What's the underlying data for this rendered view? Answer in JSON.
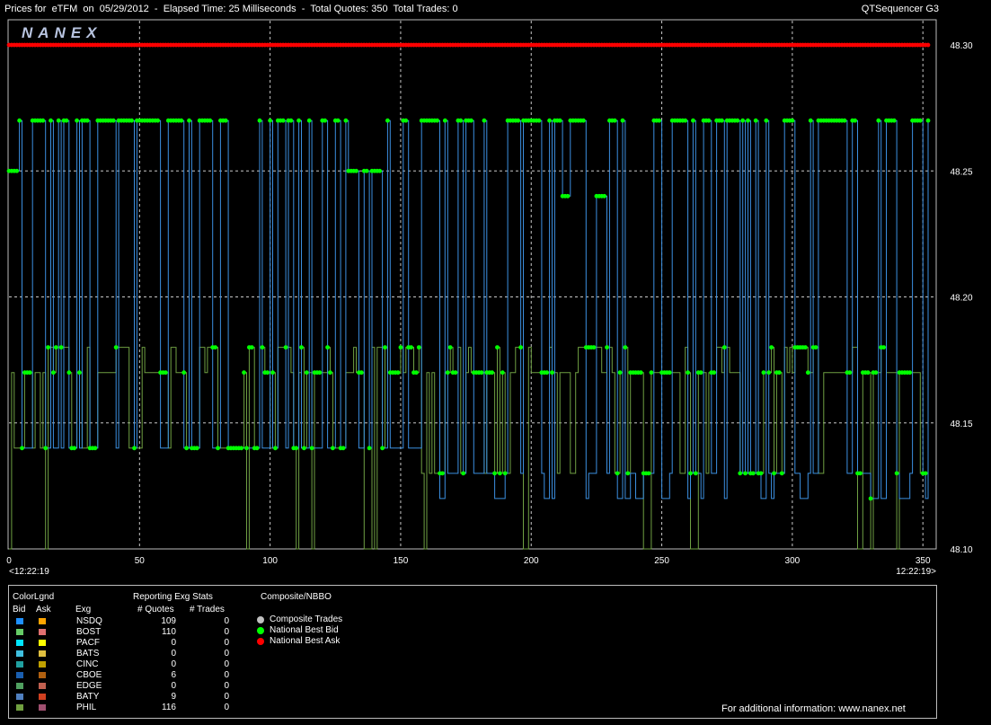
{
  "header": {
    "title": "Prices for  eTFM  on  05/29/2012  -  Elapsed Time: 25 Milliseconds  -  Total Quotes: 350  Total Trades: 0",
    "app_name": "QTSequencer G3",
    "logo": "NANEX"
  },
  "chart_data": {
    "type": "line",
    "xlim": [
      0,
      352
    ],
    "ylim": [
      48.1,
      48.31
    ],
    "x_ticks": [
      0,
      50,
      100,
      150,
      200,
      250,
      300,
      350
    ],
    "y_ticks": [
      "48.30",
      "48.25",
      "48.20",
      "48.15",
      "48.10"
    ],
    "y_tick_values": [
      48.3,
      48.25,
      48.2,
      48.15,
      48.1
    ],
    "time_start_label": "<12:22:19",
    "time_end_label": "12:22:19>",
    "grid": true,
    "national_best_ask": 48.3,
    "national_best_bid_levels": [
      48.25,
      48.27,
      48.14,
      48.13
    ],
    "series": [
      {
        "name": "National Best Bid",
        "color": "#00ff00"
      },
      {
        "name": "National Best Ask",
        "color": "#ff0000"
      }
    ]
  },
  "legend": {
    "headers": {
      "color_legend": "ColorLgnd",
      "bid": "Bid",
      "ask": "Ask",
      "exg": "Exg",
      "reporting": "Reporting Exg Stats",
      "quotes": "# Quotes",
      "trades": "# Trades",
      "composite": "Composite/NBBO"
    },
    "exchanges": [
      {
        "name": "NSDQ",
        "quotes": "109",
        "trades": "0",
        "bid_color": "#1e90ff",
        "ask_color": "#ffa500"
      },
      {
        "name": "BOST",
        "quotes": "110",
        "trades": "0",
        "bid_color": "#66cc66",
        "ask_color": "#e07070"
      },
      {
        "name": "PACF",
        "quotes": "0",
        "trades": "0",
        "bid_color": "#00e5ff",
        "ask_color": "#ffff00"
      },
      {
        "name": "BATS",
        "quotes": "0",
        "trades": "0",
        "bid_color": "#40c0e0",
        "ask_color": "#e0c040"
      },
      {
        "name": "CINC",
        "quotes": "0",
        "trades": "0",
        "bid_color": "#20a0a0",
        "ask_color": "#c0a000"
      },
      {
        "name": "CBOE",
        "quotes": "6",
        "trades": "0",
        "bid_color": "#1a5fb0",
        "ask_color": "#b06010"
      },
      {
        "name": "EDGE",
        "quotes": "0",
        "trades": "0",
        "bid_color": "#50a060",
        "ask_color": "#c06050"
      },
      {
        "name": "BATY",
        "quotes": "9",
        "trades": "0",
        "bid_color": "#5080c0",
        "ask_color": "#d04020"
      },
      {
        "name": "PHIL",
        "quotes": "116",
        "trades": "0",
        "bid_color": "#70a040",
        "ask_color": "#a05070"
      }
    ],
    "composite_items": [
      {
        "label": "Composite Trades",
        "color": "#c0c0c0"
      },
      {
        "label": "National Best Bid",
        "color": "#00ff00"
      },
      {
        "label": "National Best Ask",
        "color": "#ff0000"
      }
    ],
    "footer": "For additional information: www.nanex.net"
  }
}
